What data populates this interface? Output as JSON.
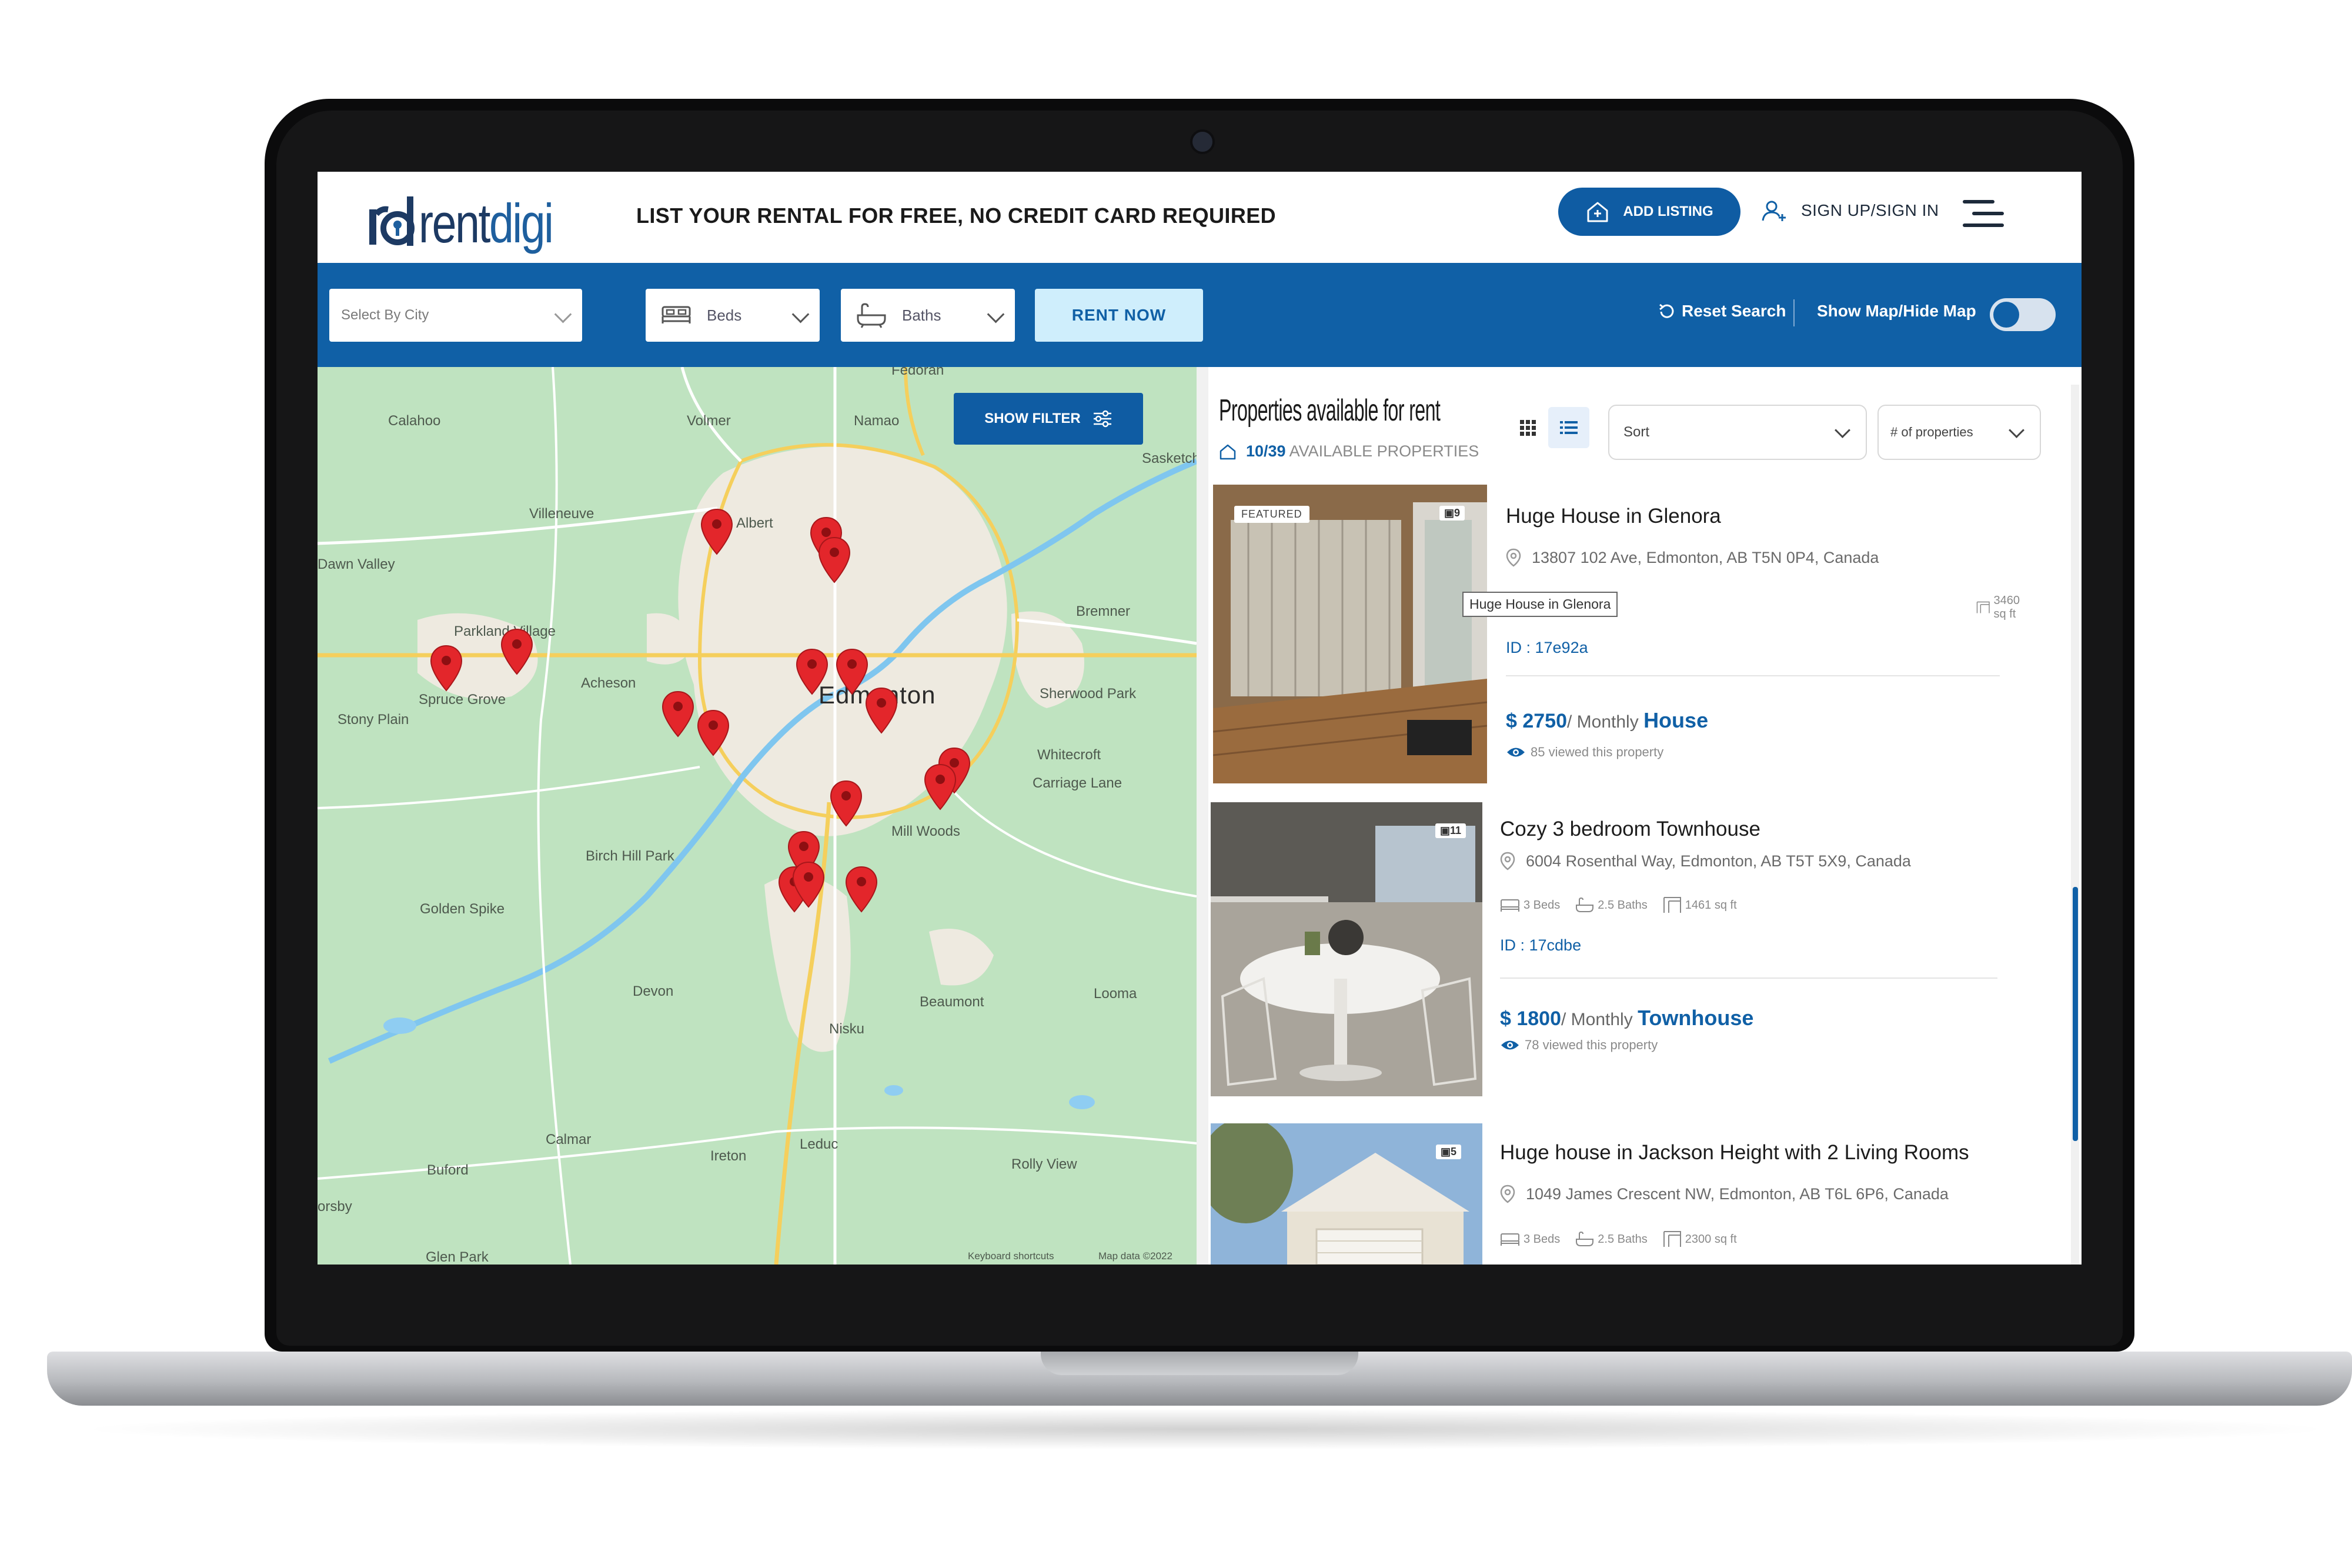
{
  "brand": {
    "logo_text_rent": "rent",
    "logo_text_digi": "digi",
    "primary_color": "#1060a6",
    "pin_color": "#e3262b"
  },
  "header": {
    "tagline": "LIST YOUR RENTAL FOR FREE, NO CREDIT CARD REQUIRED",
    "add_listing": "ADD LISTING",
    "sign_in": "SIGN UP/SIGN IN",
    "menu_icon": "hamburger-icon"
  },
  "filters": {
    "city_placeholder": "Select By City",
    "beds": "Beds",
    "baths": "Baths",
    "rent_now": "RENT NOW",
    "reset_search": "Reset Search",
    "show_hide_map": "Show Map/Hide Map",
    "map_toggle_on": true
  },
  "map": {
    "show_filter": "SHOW FILTER",
    "city_label": "Edmonton",
    "labels": [
      "Calahoo",
      "Volmer",
      "Namao",
      "Villeneuve",
      "Albert",
      "Dawn Valley",
      "Parkland Village",
      "Spruce Grove",
      "Stony Plain",
      "Acheson",
      "Bremner",
      "Sherwood Park",
      "Whitecroft",
      "Carriage Lane",
      "Mill Woods",
      "Birch Hill Park",
      "Golden Spike",
      "Devon",
      "Beaumont",
      "Nisku",
      "Leduc",
      "Looma",
      "Calmar",
      "Buford",
      "Ireton",
      "Rolly View",
      "Glen Park",
      "Fedorah",
      "Sasketchewan",
      "Keyboard shortcuts",
      "Map data ©2022",
      "orsby"
    ],
    "pin_count": 19
  },
  "listings": {
    "title": "Properties available for rent",
    "count_text": "10/39",
    "count_suffix": "AVAILABLE PROPERTIES",
    "sort_placeholder": "Sort",
    "num_placeholder": "# of properties",
    "items": [
      {
        "featured": "FEATURED",
        "photo_count": "9",
        "title": "Huge House in Glenora",
        "address": "13807 102 Ave, Edmonton, AB T5N 0P4, Canada",
        "area": "3460 sq ft",
        "tooltip": "Huge House in Glenora",
        "id": "ID : 17e92a",
        "price": "$ 2750",
        "period": "/ Monthly",
        "type": "House",
        "views": "85 viewed this property"
      },
      {
        "photo_count": "11",
        "title": "Cozy 3 bedroom Townhouse",
        "address": "6004 Rosenthal Way, Edmonton, AB T5T 5X9, Canada",
        "beds": "3 Beds",
        "baths": "2.5 Baths",
        "area": "1461 sq ft",
        "id": "ID : 17cdbe",
        "price": "$ 1800",
        "period": "/ Monthly",
        "type": "Townhouse",
        "views": "78 viewed this property"
      },
      {
        "photo_count": "5",
        "title": "Huge house in Jackson Height with 2 Living Rooms",
        "address": "1049 James Crescent NW, Edmonton, AB T6L 6P6, Canada",
        "beds": "3 Beds",
        "baths": "2.5 Baths",
        "area": "2300 sq ft"
      }
    ]
  }
}
